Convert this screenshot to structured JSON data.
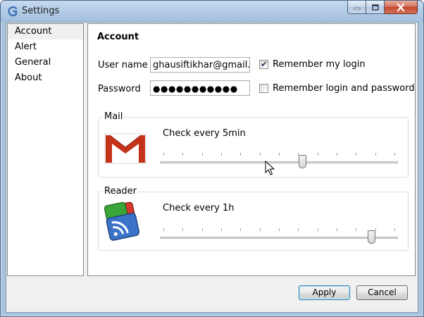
{
  "window": {
    "title": "Settings",
    "icon": "app-logo-icon",
    "controls": [
      "minimize-icon",
      "maximize-icon",
      "close-icon"
    ]
  },
  "sidebar": {
    "items": [
      {
        "label": "Account",
        "selected": true
      },
      {
        "label": "Alert",
        "selected": false
      },
      {
        "label": "General",
        "selected": false
      },
      {
        "label": "About",
        "selected": false
      }
    ]
  },
  "account": {
    "title": "Account",
    "username_label": "User name",
    "username_value": "ghausiftikhar@gmail.com",
    "password_label": "Password",
    "password_value": "●●●●●●●●●●●",
    "remember_login_label": "Remember my login",
    "remember_login_checked": true,
    "remember_password_label": "Remember login and password",
    "remember_password_checked": false
  },
  "mail": {
    "group_label": "Mail",
    "icon": "gmail-icon",
    "interval_text": "Check every 5min",
    "slider_level": 0.6
  },
  "reader": {
    "group_label": "Reader",
    "icon": "google-reader-icon",
    "interval_text": "Check every 1h",
    "slider_level": 0.9
  },
  "footer": {
    "apply_label": "Apply",
    "cancel_label": "Cancel"
  },
  "colors": {
    "gmail_red": "#c5321a",
    "reader_blue": "#3a73c8",
    "reader_green": "#3aa63a",
    "reader_red": "#d23b2b"
  }
}
